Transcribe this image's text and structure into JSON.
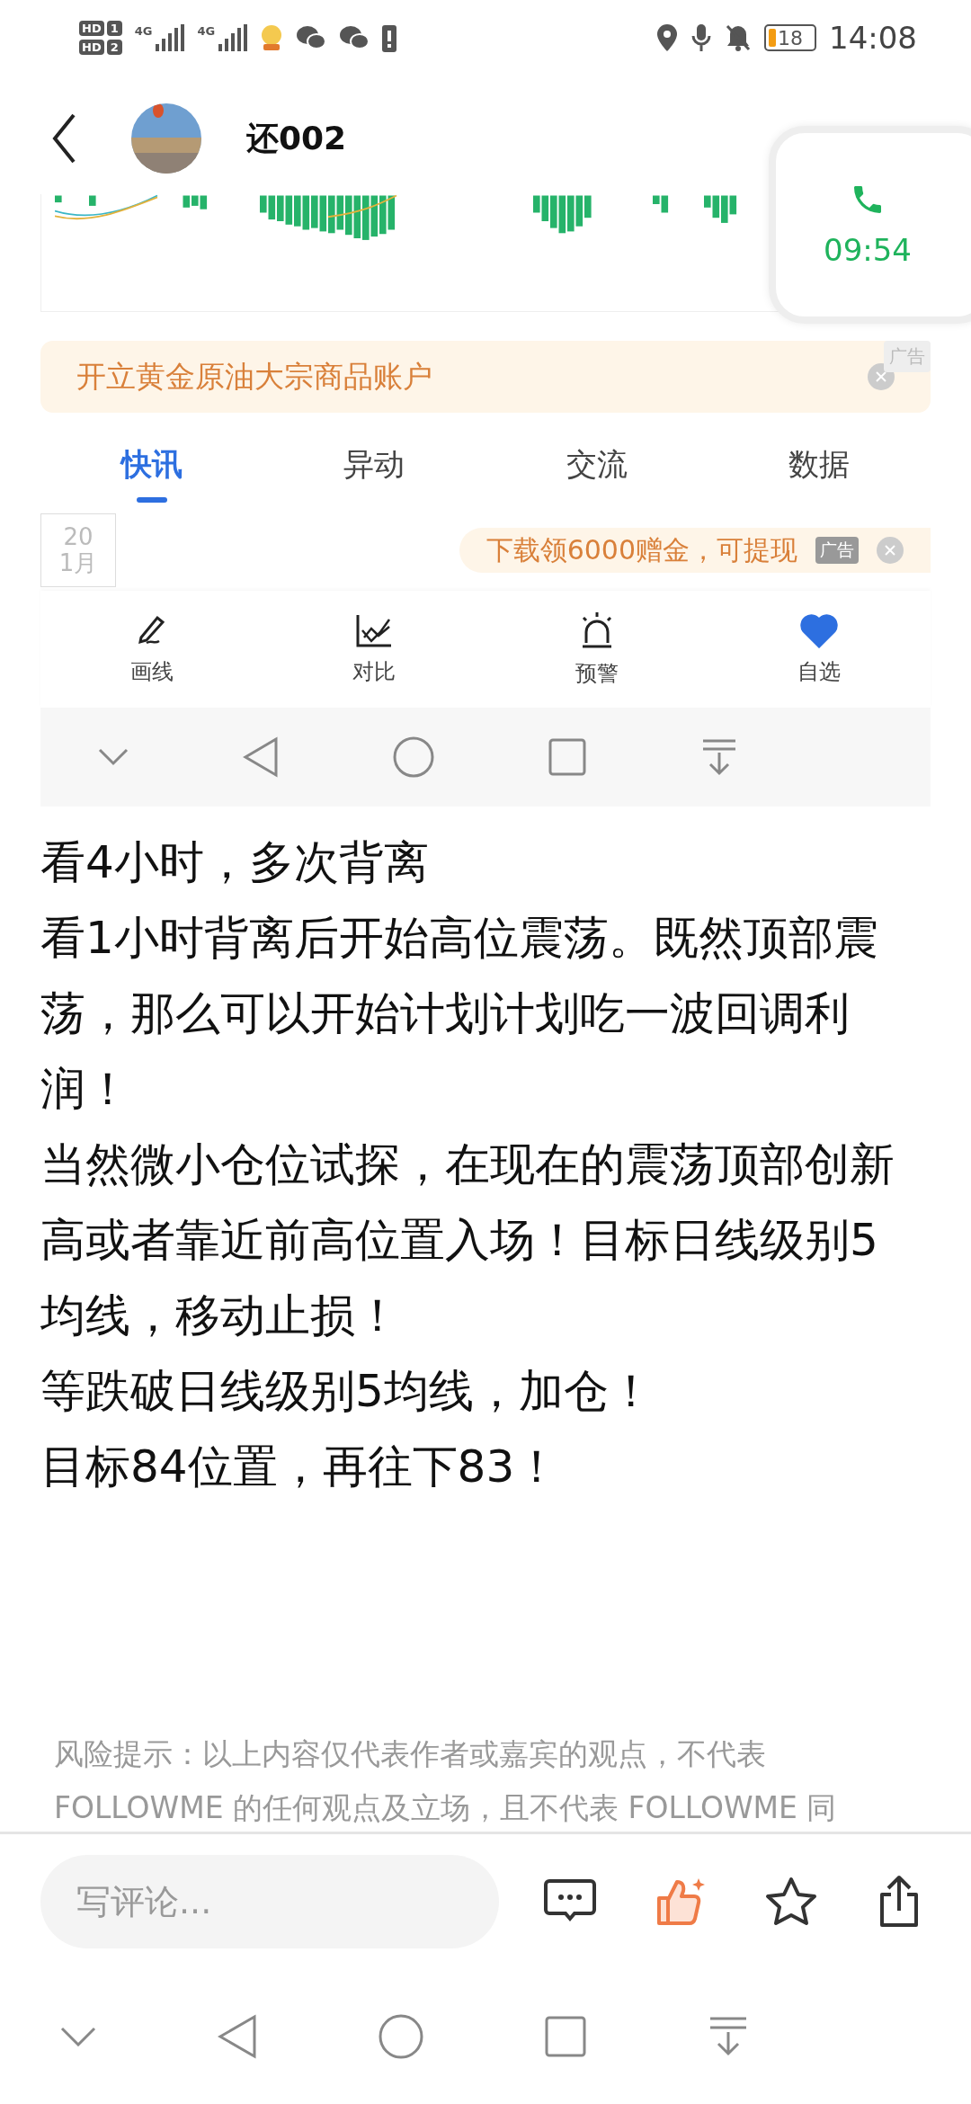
{
  "status_bar": {
    "sims": [
      {
        "label": "HD",
        "slot": "1",
        "network": "4G"
      },
      {
        "label": "HD",
        "slot": "2",
        "network": "4G"
      }
    ],
    "battery": "18",
    "time": "14:08"
  },
  "header": {
    "title": "还002"
  },
  "call_widget": {
    "duration": "09:54"
  },
  "shared_image": {
    "ad_banner": {
      "text": "开立黄金原油大宗商品账户",
      "badge": "广告"
    },
    "tabs": [
      {
        "label": "快讯",
        "selected": true
      },
      {
        "label": "异动",
        "selected": false
      },
      {
        "label": "交流",
        "selected": false
      },
      {
        "label": "数据",
        "selected": false
      }
    ],
    "date": {
      "day": "20",
      "month": "1月"
    },
    "promo": {
      "text": "下载领6000赠金，可提现",
      "badge": "广告"
    },
    "toolbar": [
      {
        "kind": "draw",
        "label": "画线",
        "selected": false
      },
      {
        "kind": "compare",
        "label": "对比",
        "selected": false
      },
      {
        "kind": "alert",
        "label": "预警",
        "selected": false
      },
      {
        "kind": "favorite",
        "label": "自选",
        "selected": true
      }
    ]
  },
  "post": {
    "paragraphs": [
      "看4小时，多次背离",
      "看1小时背离后开始高位震荡。既然顶部震荡，那么可以开始计划计划吃一波回调利润！",
      "当然微小仓位试探，在现在的震荡顶部创新高或者靠近前高位置入场！目标日线级别5均线，移动止损！",
      "等跌破日线级别5均线，加仓！",
      "目标84位置，再往下83！"
    ],
    "risk_lines": [
      "风险提示：以上内容仅代表作者或嘉宾的观点，不代表",
      "FOLLOWME 的任何观点及立场，且不代表 FOLLOWME 同"
    ]
  },
  "comment_bar": {
    "placeholder": "写评论...",
    "actions": [
      {
        "kind": "comment",
        "on": false
      },
      {
        "kind": "like",
        "on": true
      },
      {
        "kind": "star",
        "on": false
      },
      {
        "kind": "share",
        "on": false
      }
    ]
  }
}
